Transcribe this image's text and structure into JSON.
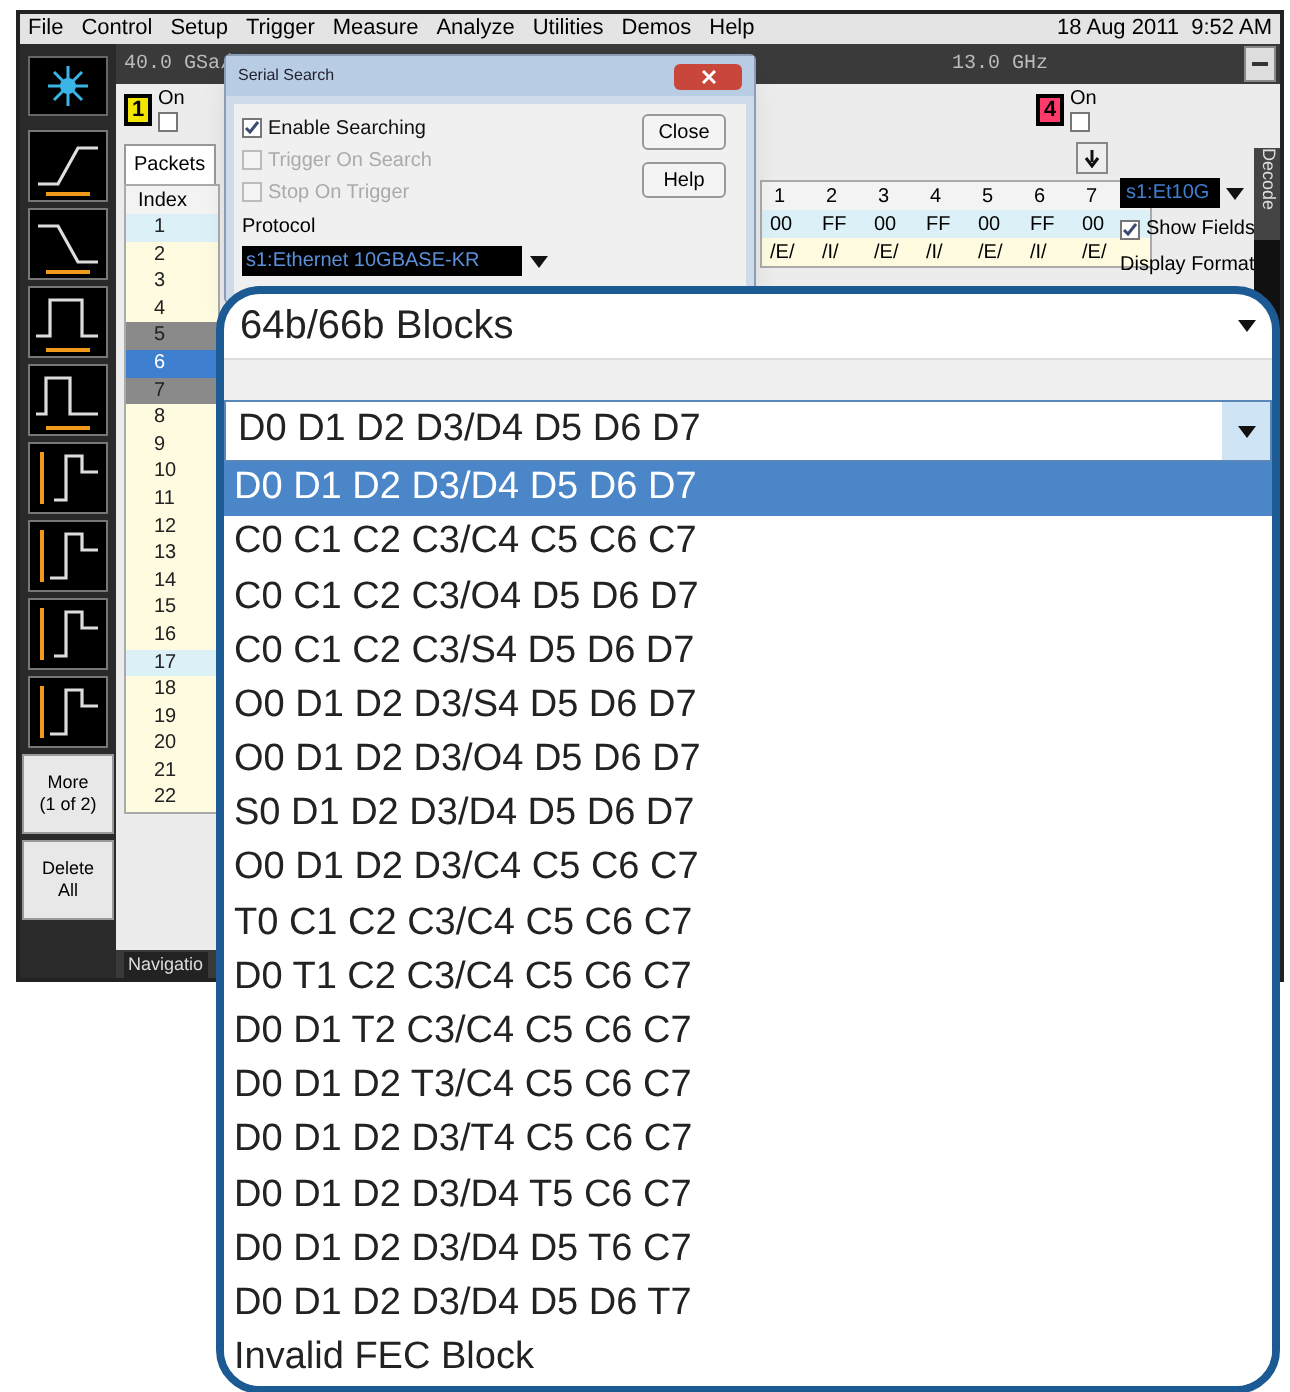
{
  "menu_bar": {
    "items": [
      "File",
      "Control",
      "Setup",
      "Trigger",
      "Measure",
      "Analyze",
      "Utilities",
      "Demos",
      "Help"
    ],
    "datetime": "18 Aug 2011  9:52 AM"
  },
  "acquisition": {
    "sample_rate": "40.0 GSa/",
    "bandwidth": "13.0 GHz"
  },
  "channels": [
    {
      "number": "1",
      "label": "On",
      "checked": false,
      "color": "#f2e600"
    },
    {
      "number": "4",
      "label": "On",
      "checked": false,
      "color": "#ff3b6b"
    }
  ],
  "left_toolbar": {
    "more_button": [
      "More",
      "(1 of 2)"
    ],
    "delete_button": [
      "Delete",
      "All"
    ]
  },
  "packets_tab": {
    "label": "Packets",
    "selected": true
  },
  "table": {
    "index_header": "Index",
    "columns": [
      "1",
      "2",
      "3",
      "4",
      "5",
      "6",
      "7"
    ],
    "rows": [
      {
        "index": "1",
        "kind": "tinted",
        "selected": false,
        "cells": [
          "00",
          "FF",
          "00",
          "FF",
          "00",
          "FF",
          "00"
        ]
      },
      {
        "index": "2",
        "kind": "normal",
        "selected": false,
        "cells": [
          "/E/",
          "/I/",
          "/E/",
          "/I/",
          "/E/",
          "/I/",
          "/E/"
        ]
      },
      {
        "index": "3",
        "kind": "normal",
        "selected": false
      },
      {
        "index": "4",
        "kind": "normal",
        "selected": false
      },
      {
        "index": "5",
        "kind": "gray",
        "selected": false
      },
      {
        "index": "6",
        "selected": true
      },
      {
        "index": "7",
        "kind": "gray",
        "selected": false
      },
      {
        "index": "8",
        "kind": "normal",
        "selected": false
      },
      {
        "index": "9",
        "kind": "normal",
        "selected": false
      },
      {
        "index": "10",
        "kind": "normal",
        "selected": false
      },
      {
        "index": "11",
        "kind": "normal",
        "selected": false
      },
      {
        "index": "12",
        "kind": "normal",
        "selected": false
      },
      {
        "index": "13",
        "kind": "normal",
        "selected": false
      },
      {
        "index": "14",
        "kind": "normal",
        "selected": false
      },
      {
        "index": "15",
        "kind": "normal",
        "selected": false
      },
      {
        "index": "16",
        "kind": "normal",
        "selected": false
      },
      {
        "index": "17",
        "kind": "tinted",
        "selected": false
      },
      {
        "index": "18",
        "kind": "normal",
        "selected": false
      },
      {
        "index": "19",
        "kind": "normal",
        "selected": false
      },
      {
        "index": "20",
        "kind": "normal",
        "selected": false
      },
      {
        "index": "21",
        "kind": "normal",
        "selected": false
      },
      {
        "index": "22",
        "kind": "normal",
        "selected": false
      }
    ]
  },
  "decode_panel": {
    "source": "s1:Et10G",
    "show_fields": {
      "label": "Show Fields",
      "checked": true
    },
    "display_format": "Display Format",
    "side_tab": "Decode"
  },
  "navigation_tab": "Navigatio",
  "serial_search_dialog": {
    "title": "Serial Search",
    "options": [
      {
        "label": "Enable Searching",
        "checked": true,
        "disabled": false
      },
      {
        "label": "Trigger On Search",
        "checked": false,
        "disabled": true
      },
      {
        "label": "Stop On Trigger",
        "checked": false,
        "disabled": true
      }
    ],
    "buttons": [
      "Close",
      "Help"
    ],
    "protocol_label": "Protocol",
    "protocol": "s1:Ethernet 10GBASE-KR"
  },
  "callout": {
    "heading": "64b/66b Blocks",
    "dropdown_value": "D0 D1 D2 D3/D4 D5 D6 D7",
    "options": [
      {
        "label": "D0 D1 D2 D3/D4 D5 D6 D7",
        "selected": true
      },
      {
        "label": "C0 C1 C2 C3/C4 C5 C6 C7",
        "selected": false
      },
      {
        "label": "C0 C1 C2 C3/O4 D5 D6 D7",
        "selected": false
      },
      {
        "label": "C0 C1 C2 C3/S4 D5 D6 D7",
        "selected": false
      },
      {
        "label": "O0 D1 D2 D3/S4 D5 D6 D7",
        "selected": false
      },
      {
        "label": "O0 D1 D2 D3/O4 D5 D6 D7",
        "selected": false
      },
      {
        "label": "S0 D1 D2 D3/D4 D5 D6 D7",
        "selected": false
      },
      {
        "label": "O0 D1 D2 D3/C4 C5 C6 C7",
        "selected": false
      },
      {
        "label": "T0 C1 C2 C3/C4 C5 C6 C7",
        "selected": false
      },
      {
        "label": "D0 T1 C2 C3/C4 C5 C6 C7",
        "selected": false
      },
      {
        "label": "D0 D1 T2 C3/C4 C5 C6 C7",
        "selected": false
      },
      {
        "label": "D0 D1 D2 T3/C4 C5 C6 C7",
        "selected": false
      },
      {
        "label": "D0 D1 D2 D3/T4 C5 C6 C7",
        "selected": false
      },
      {
        "label": "D0 D1 D2 D3/D4 T5 C6 C7",
        "selected": false
      },
      {
        "label": "D0 D1 D2 D3/D4 D5 T6 C7",
        "selected": false
      },
      {
        "label": "D0 D1 D2 D3/D4 D5 D6 T7",
        "selected": false
      },
      {
        "label": "Invalid FEC Block",
        "selected": false
      }
    ]
  }
}
